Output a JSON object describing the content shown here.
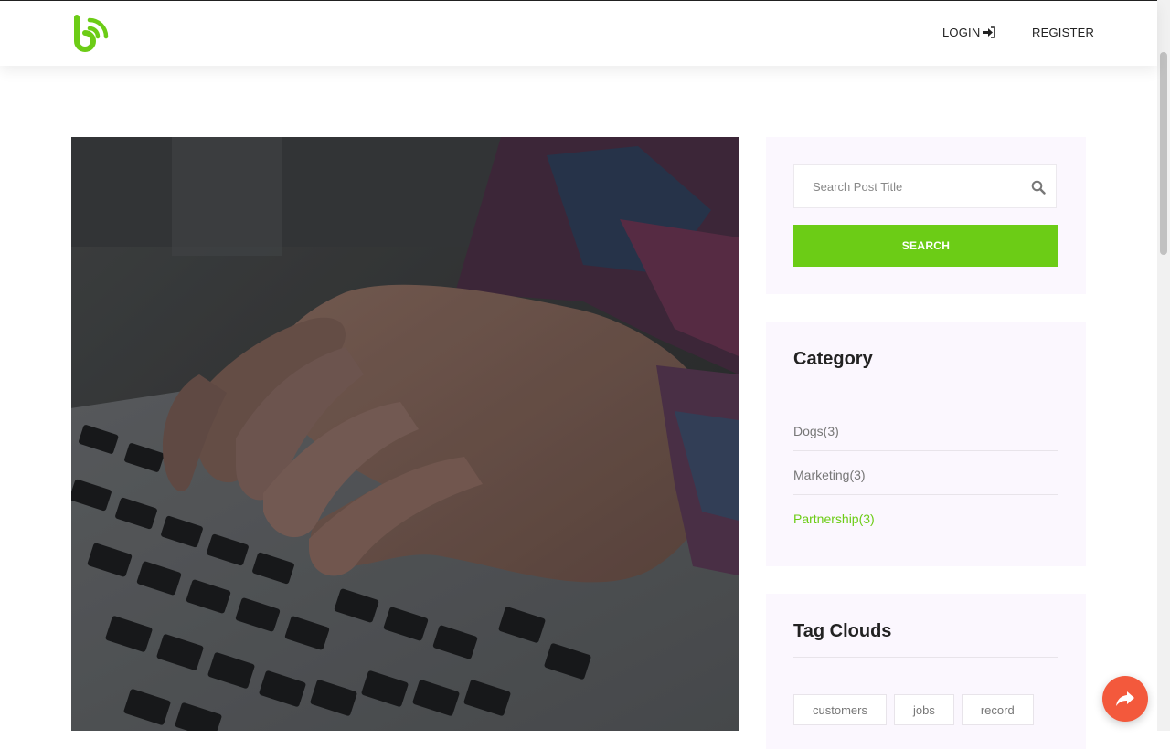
{
  "header": {
    "logo_name": "brand-logo",
    "nav": {
      "login_label": "LOGIN",
      "register_label": "REGISTER"
    }
  },
  "colors": {
    "accent": "#6ccc16",
    "share_button": "#f3593c",
    "widget_bg": "#fbf7fe"
  },
  "search_widget": {
    "placeholder": "Search Post Title",
    "button_label": "SEARCH"
  },
  "category_widget": {
    "title": "Category",
    "items": [
      {
        "label": "Dogs(3)"
      },
      {
        "label": "Marketing(3)"
      },
      {
        "label": "Partnership(3)"
      }
    ]
  },
  "tags_widget": {
    "title": "Tag Clouds",
    "tags": [
      {
        "label": "customers"
      },
      {
        "label": "jobs"
      },
      {
        "label": "record"
      }
    ]
  },
  "icons": [
    "login-icon",
    "search-icon",
    "share-icon"
  ]
}
